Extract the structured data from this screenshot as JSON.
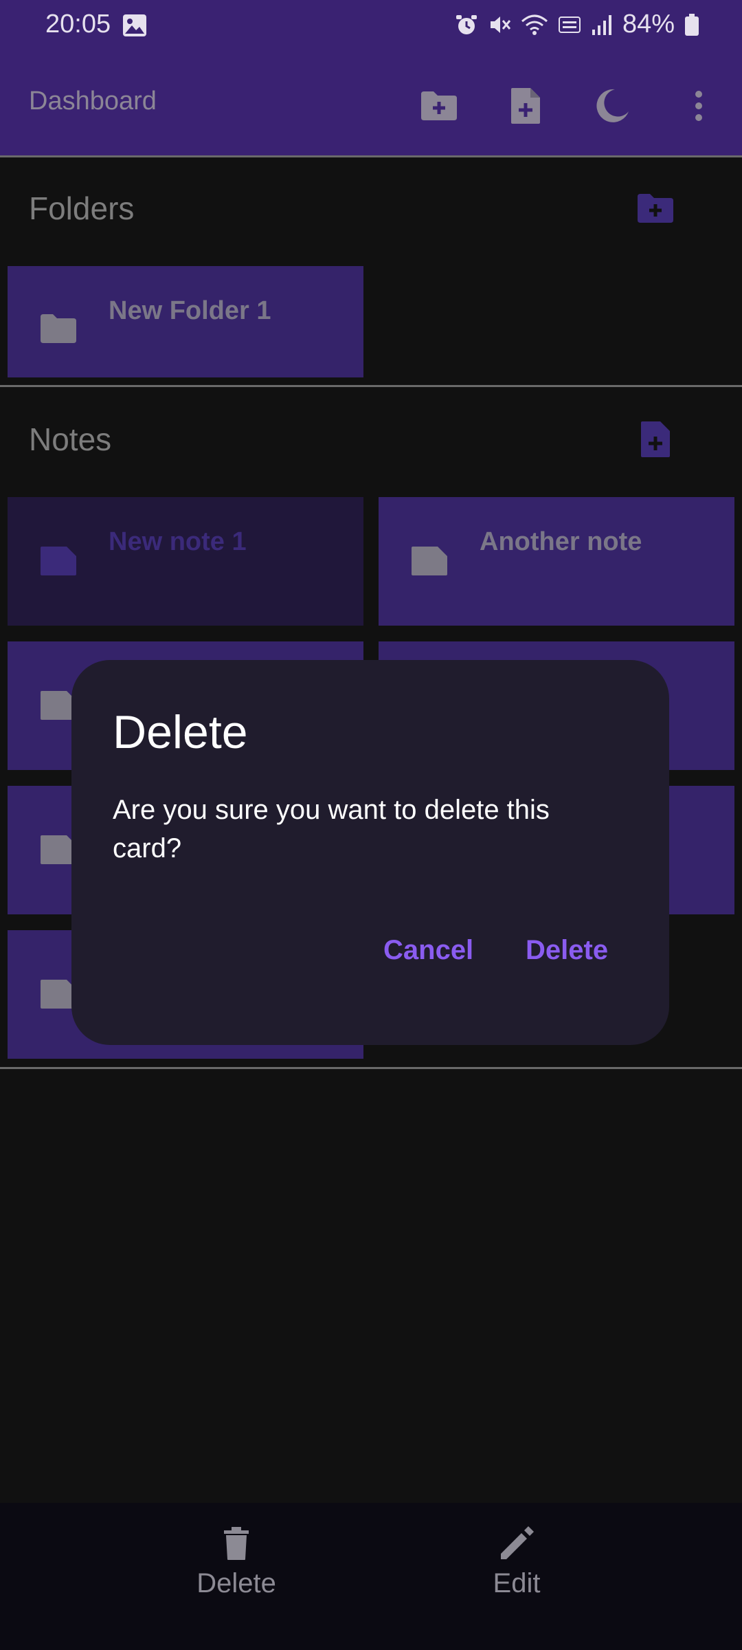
{
  "status_bar": {
    "time": "20:05",
    "battery": "84%"
  },
  "app_bar": {
    "title": "Dashboard",
    "actions": [
      "new-folder-icon",
      "new-note-icon",
      "dark-mode-icon",
      "more-options-icon"
    ]
  },
  "folders": {
    "title": "Folders",
    "items": [
      {
        "label": "New Folder 1"
      }
    ]
  },
  "notes": {
    "title": "Notes",
    "items": [
      {
        "label": "New note 1",
        "selected": true
      },
      {
        "label": "Another note",
        "selected": false
      }
    ]
  },
  "dialog": {
    "title": "Delete",
    "message": "Are you sure you want to delete this card?",
    "cancel_label": "Cancel",
    "confirm_label": "Delete"
  },
  "bottom_bar": {
    "delete_label": "Delete",
    "edit_label": "Edit"
  },
  "colors": {
    "app_bar": "#3a2272",
    "card": "#35236a",
    "card_selected": "#20173a",
    "dialog_bg": "#201c2d",
    "accent": "#8a5cf0",
    "background": "#111111"
  }
}
